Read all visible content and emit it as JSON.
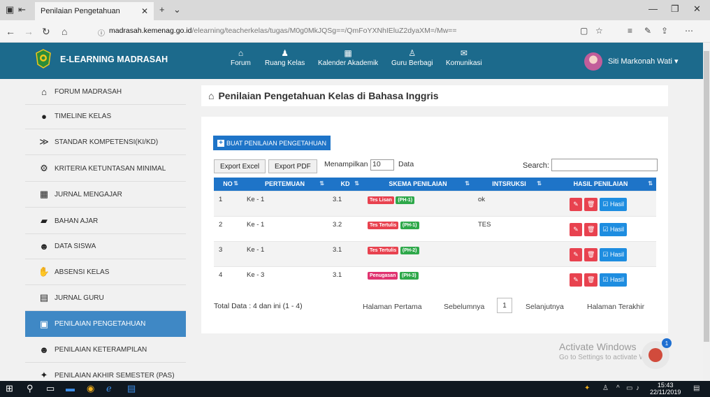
{
  "browser": {
    "tab_title": "Penilaian Pengetahuan",
    "url_host": "madrasah.kemenag.go.id",
    "url_path": "/elearning/teacherkelas/tugas/M0g0MkJQSg==/QmFoYXNhIEluZ2dyaXM=/Mw=="
  },
  "header": {
    "brand": "E-LEARNING MADRASAH",
    "nav": [
      {
        "label": "Forum",
        "icon": "home-icon"
      },
      {
        "label": "Ruang Kelas",
        "icon": "classroom-icon"
      },
      {
        "label": "Kalender Akademik",
        "icon": "calendar-icon"
      },
      {
        "label": "Guru Berbagi",
        "icon": "user-icon"
      },
      {
        "label": "Komunikasi",
        "icon": "mail-icon"
      }
    ],
    "user_name": "Siti Markonah Wati"
  },
  "sidebar": {
    "items": [
      {
        "label": "FORUM MADRASAH",
        "icon": "home-icon"
      },
      {
        "label": "TIMELINE KELAS",
        "icon": "github-icon"
      },
      {
        "label": "STANDAR KOMPETENSI(KI/KD)",
        "icon": "signal-icon"
      },
      {
        "label": "KRITERIA KETUNTASAN MINIMAL",
        "icon": "settings-icon"
      },
      {
        "label": "JURNAL MENGAJAR",
        "icon": "calendar-icon"
      },
      {
        "label": "BAHAN AJAR",
        "icon": "folder-icon"
      },
      {
        "label": "DATA SISWA",
        "icon": "users-icon"
      },
      {
        "label": "ABSENSI KELAS",
        "icon": "handshake-icon"
      },
      {
        "label": "JURNAL GURU",
        "icon": "calendar-plus-icon"
      },
      {
        "label": "PENILAIAN PENGETAHUAN",
        "icon": "clipboard-icon"
      },
      {
        "label": "PENILAIAN KETERAMPILAN",
        "icon": "users-group-icon"
      },
      {
        "label": "PENILAIAN AKHIR SEMESTER (PAS)",
        "icon": "puzzle-icon"
      }
    ],
    "active_index": 9
  },
  "main": {
    "title": "Penilaian Pengetahuan Kelas di Bahasa Inggris",
    "create_button": "BUAT PENILAIAN PENGETAHUAN",
    "export_excel": "Export Excel",
    "export_pdf": "Export PDF",
    "show_label": "Menampilkan",
    "page_length": "10",
    "data_label": "Data",
    "search_label": "Search:",
    "search_value": "",
    "columns": [
      "NO",
      "PERTEMUAN",
      "KD",
      "SKEMA PENILAIAN",
      "INTSRUKSI",
      "HASIL PENILAIAN"
    ],
    "rows": [
      {
        "no": "1",
        "pertemuan": "Ke - 1",
        "kd": "3.1",
        "skema": "Tes Lisan",
        "skema_color": "red",
        "kode": "(PH-1)",
        "instruksi": "ok"
      },
      {
        "no": "2",
        "pertemuan": "Ke - 1",
        "kd": "3.2",
        "skema": "Tes Tertulis",
        "skema_color": "red",
        "kode": "(PH-1)",
        "instruksi": "TES"
      },
      {
        "no": "3",
        "pertemuan": "Ke - 1",
        "kd": "3.1",
        "skema": "Tes Tertulis",
        "skema_color": "red",
        "kode": "(PH-2)",
        "instruksi": ""
      },
      {
        "no": "4",
        "pertemuan": "Ke - 3",
        "kd": "3.1",
        "skema": "Penugasan",
        "skema_color": "pink",
        "kode": "(PH-3)",
        "instruksi": ""
      }
    ],
    "result_button": "Hasil",
    "total_text": "Total Data : 4 dan ini (1 - 4)",
    "pagination": {
      "first": "Halaman Pertama",
      "prev": "Sebelumnya",
      "current": "1",
      "next": "Selanjutnya",
      "last": "Halaman Terakhir"
    }
  },
  "watermark": {
    "line1": "Activate Windows",
    "line2": "Go to Settings to activate Windows."
  },
  "chat_badge": "1",
  "taskbar": {
    "time": "15:43",
    "date": "22/11/2019"
  },
  "colors": {
    "header": "#1c6a8c",
    "primary": "#1e74c8",
    "sidebar_active": "#3f88c5",
    "danger": "#e8424f",
    "success": "#2ea84a"
  }
}
